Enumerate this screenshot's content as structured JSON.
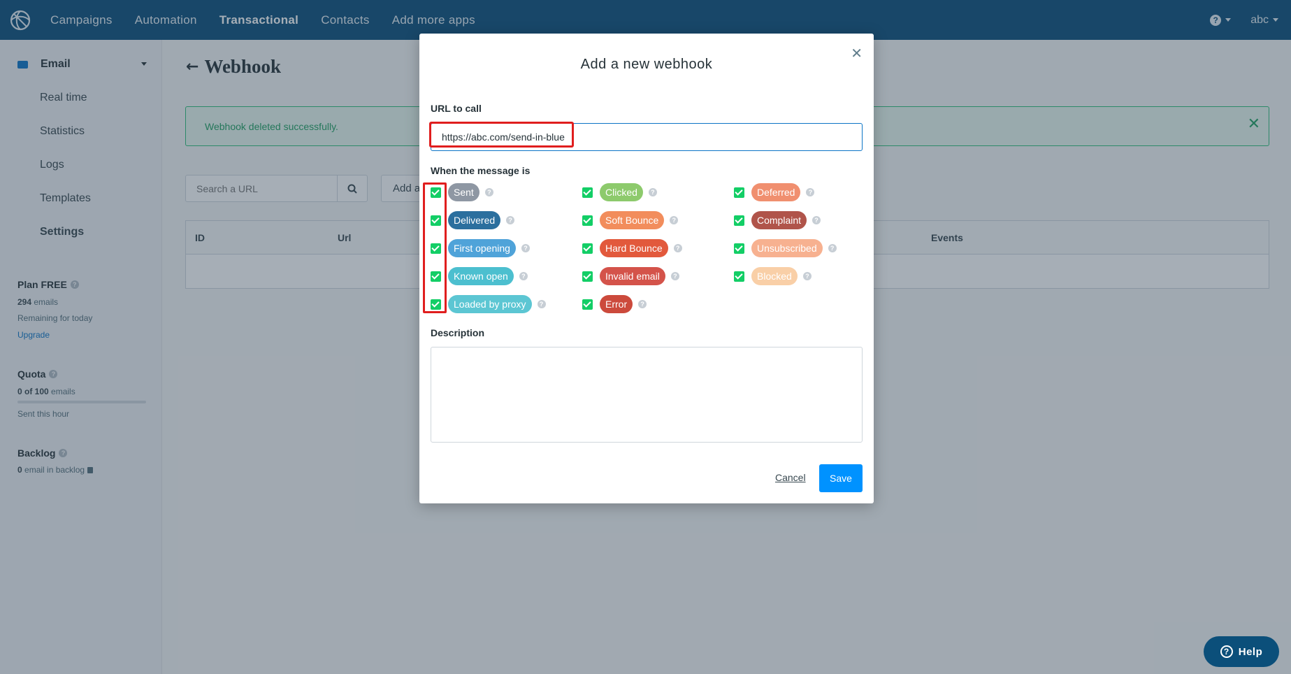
{
  "topnav": {
    "items": [
      "Campaigns",
      "Automation",
      "Transactional",
      "Contacts",
      "Add more apps"
    ],
    "active": "Transactional",
    "help_glyph": "?",
    "user": "abc"
  },
  "sidebar": {
    "section": "Email",
    "links": [
      "Real time",
      "Statistics",
      "Logs",
      "Templates",
      "Settings"
    ],
    "plan": {
      "title": "Plan FREE",
      "count": "294",
      "count_unit": " emails",
      "remaining": "Remaining for today",
      "upgrade": "Upgrade"
    },
    "quota": {
      "title": "Quota",
      "used": "0 of 100",
      "unit": " emails",
      "sent": "Sent this hour",
      "fill": 0
    },
    "backlog": {
      "title": "Backlog",
      "count": "0",
      "text": " email in backlog"
    }
  },
  "main": {
    "title": "Webhook",
    "alert": "Webhook deleted successfully.",
    "search_placeholder": "Search a URL",
    "add_label": "Add a",
    "table_headers": [
      "ID",
      "Url",
      "Events"
    ]
  },
  "modal": {
    "title": "Add a new webhook",
    "url_label": "URL to call",
    "url_value": "https://abc.com/send-in-blue",
    "events_label": "When the message is",
    "events": [
      [
        {
          "label": "Sent",
          "color": "#8e97a3"
        },
        {
          "label": "Delivered",
          "color": "#2b6f9e"
        },
        {
          "label": "First opening",
          "color": "#4fa3d9"
        },
        {
          "label": "Known open",
          "color": "#4cbfcf"
        },
        {
          "label": "Loaded by proxy",
          "color": "#5cc6d3"
        }
      ],
      [
        {
          "label": "Clicked",
          "color": "#8dca6c"
        },
        {
          "label": "Soft Bounce",
          "color": "#f28d5c"
        },
        {
          "label": "Hard Bounce",
          "color": "#e2593c"
        },
        {
          "label": "Invalid email",
          "color": "#d4534a"
        },
        {
          "label": "Error",
          "color": "#cc4a3c"
        }
      ],
      [
        {
          "label": "Deferred",
          "color": "#f08f6f"
        },
        {
          "label": "Complaint",
          "color": "#b0544a"
        },
        {
          "label": "Unsubscribed",
          "color": "#f7b190"
        },
        {
          "label": "Blocked",
          "color": "#f9cfa7"
        }
      ]
    ],
    "description_label": "Description",
    "cancel_label": "Cancel",
    "save_label": "Save"
  },
  "help_button": "Help",
  "colors": {
    "nav_bg": "#0b4f7a",
    "success": "#21a162",
    "primary": "#0092ff",
    "checkbox": "#13ce66",
    "highlight": "#e01e1e"
  }
}
